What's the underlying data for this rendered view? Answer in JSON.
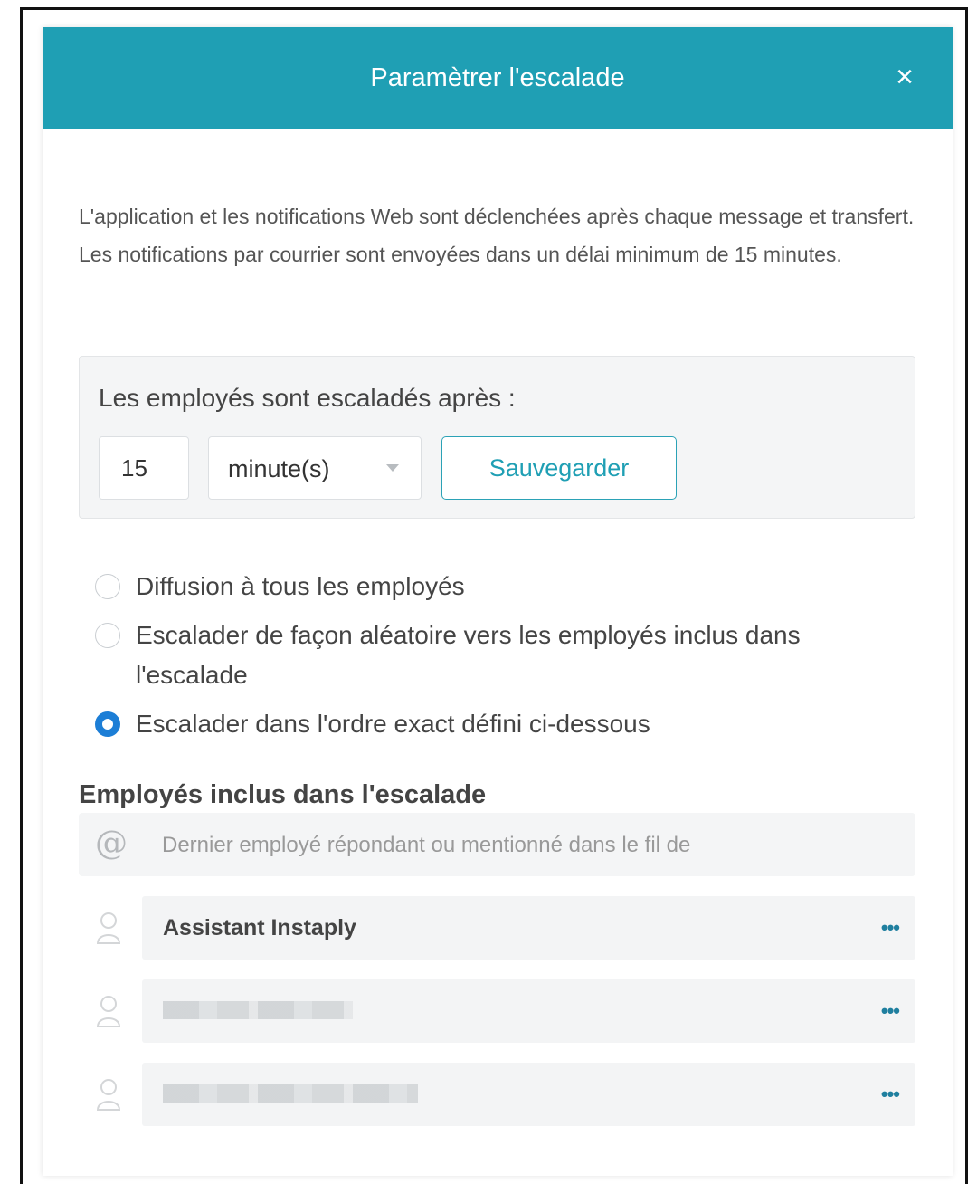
{
  "modal": {
    "title": "Paramètrer l'escalade",
    "close_label": "×"
  },
  "info": {
    "line1": "L'application et les notifications Web sont déclenchées après chaque message et transfert.",
    "line2": "Les notifications par courrier sont envoyées dans un délai minimum de 15 minutes."
  },
  "delay": {
    "label": "Les employés sont escaladés après :",
    "value": "15",
    "unit": "minute(s)",
    "save_label": "Sauvegarder"
  },
  "escalation_modes": [
    {
      "label": "Diffusion à tous les employés",
      "selected": false
    },
    {
      "label": "Escalader de façon aléatoire vers les employés inclus dans l'escalade",
      "selected": false
    },
    {
      "label": "Escalader dans l'ordre exact défini ci-dessous",
      "selected": true
    }
  ],
  "employees_section": {
    "title": "Employés inclus dans l'escalade",
    "mention_icon": "@",
    "mention_text": "Dernier employé répondant ou mentionné dans le fil de",
    "more_label": "•••",
    "employees": [
      {
        "name": "Assistant Instaply",
        "redacted": false
      },
      {
        "name": "",
        "redacted": true
      },
      {
        "name": "",
        "redacted": true
      }
    ]
  },
  "colors": {
    "header": "#1f9fb4",
    "accent": "#1c7ed6",
    "save_border": "#2ba2b6"
  }
}
